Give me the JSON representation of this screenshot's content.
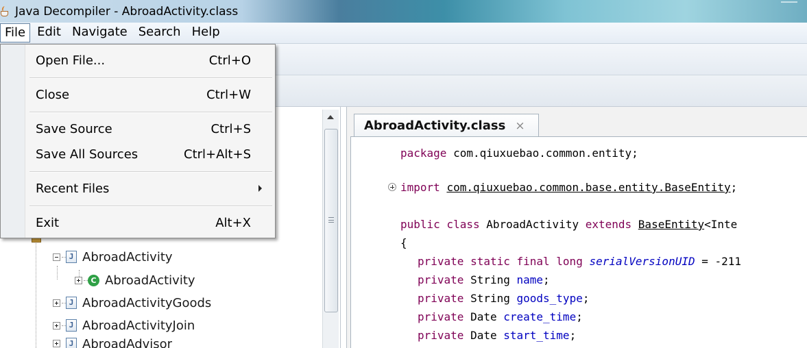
{
  "window": {
    "title": "Java Decompiler - AbroadActivity.class"
  },
  "menubar": {
    "items": [
      {
        "label": "File"
      },
      {
        "label": "Edit"
      },
      {
        "label": "Navigate"
      },
      {
        "label": "Search"
      },
      {
        "label": "Help"
      }
    ]
  },
  "file_menu": {
    "items": [
      {
        "label": "Open File...",
        "shortcut": "Ctrl+O"
      },
      {
        "label": "Close",
        "shortcut": "Ctrl+W"
      },
      {
        "label": "Save Source",
        "shortcut": "Ctrl+S"
      },
      {
        "label": "Save All Sources",
        "shortcut": "Ctrl+Alt+S"
      },
      {
        "label": "Recent Files",
        "shortcut": ""
      },
      {
        "label": "Exit",
        "shortcut": "Alt+X"
      }
    ]
  },
  "tree": {
    "items": [
      {
        "label": "AbroadActivity",
        "icon": "java-file-icon"
      },
      {
        "label": "AbroadActivity",
        "icon": "class-icon"
      },
      {
        "label": "AbroadActivityGoods",
        "icon": "java-file-icon"
      },
      {
        "label": "AbroadActivityJoin",
        "icon": "java-file-icon"
      },
      {
        "label": "AbroadAdvisor",
        "icon": "java-file-icon"
      }
    ]
  },
  "editor": {
    "tab": {
      "label": "AbroadActivity.class",
      "close": "×"
    },
    "code": {
      "l1": {
        "kw": "package",
        "rest": " com.qiuxuebao.common.entity;"
      },
      "l2": {
        "kw": "import",
        "space": " ",
        "ref": "com.qiuxuebao.common.base.entity.BaseEntity",
        "rest": ";"
      },
      "l3": {
        "kw": "public class",
        "name": " AbroadActivity ",
        "kw2": "extends",
        "space": " ",
        "ref": "BaseEntity",
        "rest": "<Inte"
      },
      "l4": {
        "text": "{"
      },
      "l5": {
        "kw": "private static final long",
        "space": " ",
        "field": "serialVersionUID",
        "rest": " = -211"
      },
      "l6": {
        "kw": "private",
        "type": " String ",
        "field": "name",
        "rest": ";"
      },
      "l7": {
        "kw": "private",
        "type": " String ",
        "field": "goods_type",
        "rest": ";"
      },
      "l8": {
        "kw": "private",
        "type": " Date ",
        "field": "create_time",
        "rest": ";"
      },
      "l9": {
        "kw": "private",
        "type": " Date ",
        "field": "start_time",
        "rest": ";"
      }
    }
  }
}
